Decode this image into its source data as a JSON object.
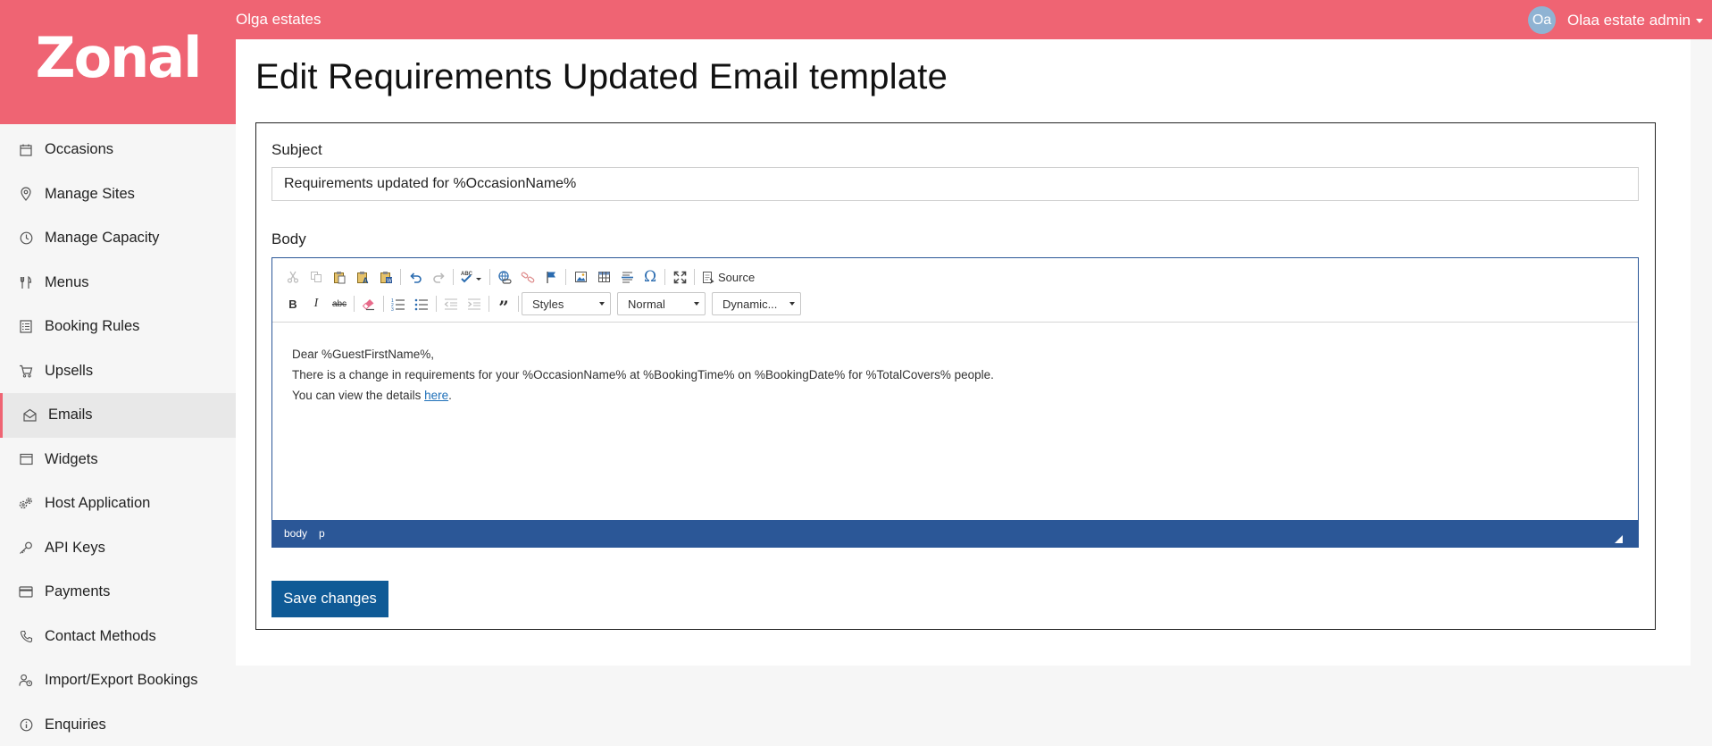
{
  "header": {
    "org_name": "Olga estates",
    "avatar_initials": "Oa",
    "user_name": "Olaa estate admin"
  },
  "brand": {
    "logo_text": "Zonal",
    "accent_color": "#ef6473",
    "primary_button_color": "#0f5a96",
    "editor_border_color": "#2b5797"
  },
  "sidebar": {
    "items": [
      {
        "label": "Occasions",
        "icon": "calendar-icon"
      },
      {
        "label": "Manage Sites",
        "icon": "location-pin-icon"
      },
      {
        "label": "Manage Capacity",
        "icon": "clock-icon"
      },
      {
        "label": "Menus",
        "icon": "cutlery-icon"
      },
      {
        "label": "Booking Rules",
        "icon": "list-icon"
      },
      {
        "label": "Upsells",
        "icon": "cart-icon"
      },
      {
        "label": "Emails",
        "icon": "envelope-open-icon",
        "active": true
      },
      {
        "label": "Widgets",
        "icon": "window-icon"
      },
      {
        "label": "Host Application",
        "icon": "gears-icon"
      },
      {
        "label": "API Keys",
        "icon": "key-icon"
      },
      {
        "label": "Payments",
        "icon": "credit-card-icon"
      },
      {
        "label": "Contact Methods",
        "icon": "phone-icon"
      },
      {
        "label": "Import/Export Bookings",
        "icon": "user-sync-icon"
      },
      {
        "label": "Enquiries",
        "icon": "info-icon"
      }
    ]
  },
  "main": {
    "title": "Edit Requirements Updated Email template",
    "subject_label": "Subject",
    "subject_value": "Requirements updated for %OccasionName%",
    "body_label": "Body",
    "save_label": "Save changes"
  },
  "editor": {
    "source_label": "Source",
    "styles_label": "Styles",
    "format_label": "Normal",
    "dynamic_label": "Dynamic...",
    "lines": {
      "line1": "Dear %GuestFirstName%,",
      "line2": "There is a change in requirements for your %OccasionName% at %BookingTime% on %BookingDate% for %TotalCovers% people.",
      "line3_prefix": "You can view the details ",
      "line3_link": "here",
      "line3_suffix": "."
    },
    "status_path": [
      "body",
      "p"
    ]
  }
}
